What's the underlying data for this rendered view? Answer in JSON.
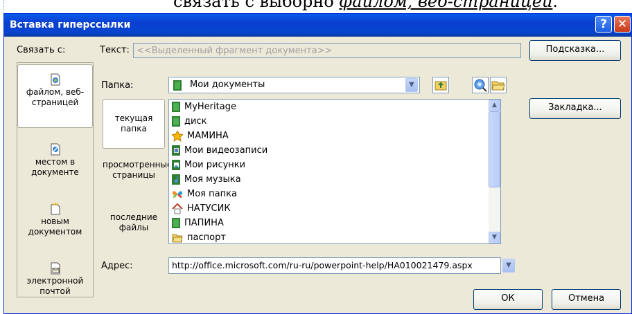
{
  "background_text": {
    "prefix": "связать с выборно",
    "link": "файлом, веб-страницей",
    "suffix": "."
  },
  "dialog": {
    "title": "Вставка гиперссылки",
    "help_button": "?",
    "close_button": "✕"
  },
  "link_with": {
    "label": "Связать с:",
    "items": [
      {
        "label": "файлом, веб-страницей",
        "icon": "file-web-icon",
        "selected": true
      },
      {
        "label": "местом в документе",
        "icon": "place-in-document-icon",
        "selected": false
      },
      {
        "label": "новым документом",
        "icon": "new-document-icon",
        "selected": false
      },
      {
        "label": "электронной почтой",
        "icon": "email-icon",
        "selected": false
      }
    ]
  },
  "text_field": {
    "label": "Текст:",
    "placeholder": "<<Выделенный фрагмент документа>>"
  },
  "hint_button": "Подсказка...",
  "bookmark_button": "Закладка...",
  "folder": {
    "label": "Папка:",
    "value": "Мои документы"
  },
  "tabs": [
    {
      "label": "текущая папка",
      "selected": true
    },
    {
      "label": "просмотренные страницы",
      "selected": false
    },
    {
      "label": "последние файлы",
      "selected": false
    }
  ],
  "files": [
    {
      "name": "MyHeritage",
      "icon": "folder-green-icon"
    },
    {
      "name": "диск",
      "icon": "folder-green-icon"
    },
    {
      "name": "МАМИНА",
      "icon": "star-folder-icon"
    },
    {
      "name": "Мои видеозаписи",
      "icon": "video-folder-icon"
    },
    {
      "name": "Мои рисунки",
      "icon": "pictures-folder-icon"
    },
    {
      "name": "Моя музыка",
      "icon": "music-folder-icon"
    },
    {
      "name": "Моя папка",
      "icon": "butterfly-folder-icon"
    },
    {
      "name": "НАТУСИК",
      "icon": "house-folder-icon"
    },
    {
      "name": "ПАПИНА",
      "icon": "folder-green-icon"
    },
    {
      "name": "паспорт",
      "icon": "folder-open-icon"
    }
  ],
  "address": {
    "label": "Адрес:",
    "value": "http://office.microsoft.com/ru-ru/powerpoint-help/HA010021479.aspx"
  },
  "ok_button": "ОК",
  "cancel_button": "Отмена",
  "colors": {
    "titlebar": "#0a3fd0",
    "dialog_bg": "#ece9d8",
    "folder_green": "#2e7d32"
  }
}
